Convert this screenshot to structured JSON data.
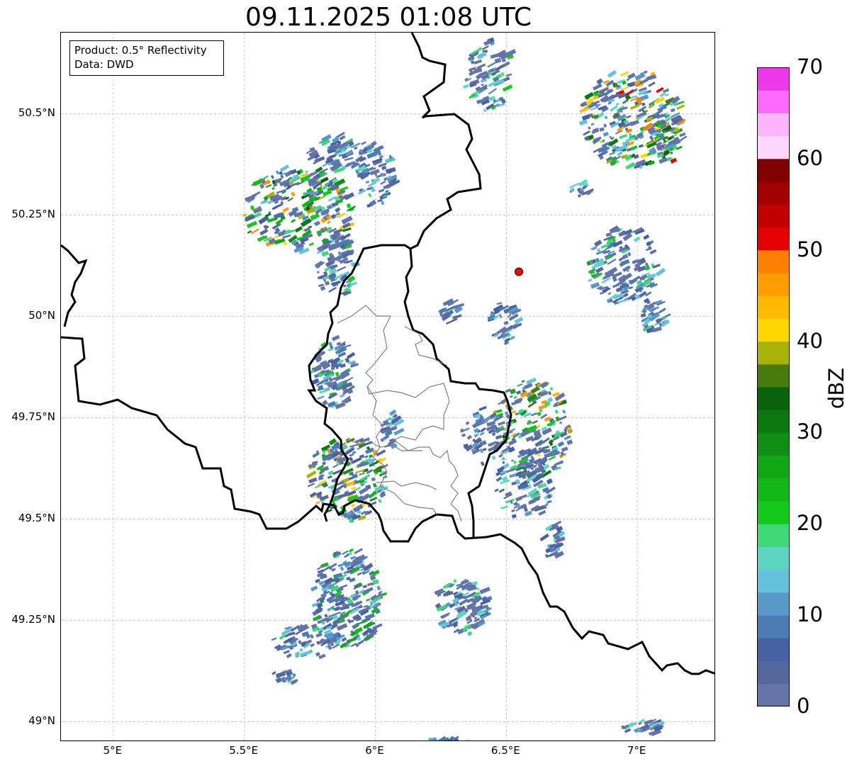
{
  "title": "09.11.2025 01:08 UTC",
  "info": {
    "product": "Product: 0.5° Reflectivity",
    "source": "Data: DWD"
  },
  "axes": {
    "lat_ticks": [
      {
        "label": "50.5°N",
        "value": 50.5
      },
      {
        "label": "50.25°N",
        "value": 50.25
      },
      {
        "label": "50°N",
        "value": 50.0
      },
      {
        "label": "49.75°N",
        "value": 49.75
      },
      {
        "label": "49.5°N",
        "value": 49.5
      },
      {
        "label": "49.25°N",
        "value": 49.25
      },
      {
        "label": "49°N",
        "value": 49.0
      }
    ],
    "lon_ticks": [
      {
        "label": "5°E",
        "value": 5.0
      },
      {
        "label": "5.5°E",
        "value": 5.5
      },
      {
        "label": "6°E",
        "value": 6.0
      },
      {
        "label": "6.5°E",
        "value": 6.5
      },
      {
        "label": "7°E",
        "value": 7.0
      }
    ],
    "lon_range": [
      4.8,
      7.3
    ],
    "lat_range": [
      48.95,
      50.7
    ],
    "grid": true
  },
  "radar_site": {
    "lon": 6.548,
    "lat": 50.11,
    "color": "#ff0000"
  },
  "colorbar": {
    "label": "dBZ",
    "min": 0,
    "max": 70,
    "ticks": [
      "0",
      "10",
      "20",
      "30",
      "40",
      "50",
      "60",
      "70"
    ],
    "colors": [
      "#6474a8",
      "#55689e",
      "#4560a3",
      "#4a7cb2",
      "#5899c8",
      "#66c1dc",
      "#5fd6c4",
      "#3ed878",
      "#14c81c",
      "#12b818",
      "#11a614",
      "#0e8e12",
      "#0b7810",
      "#0a620d",
      "#477b0d",
      "#a9b208",
      "#fed701",
      "#feba01",
      "#fe9c01",
      "#fe7e01",
      "#e40000",
      "#c20000",
      "#a20000",
      "#800000",
      "#fed6fe",
      "#feb4fe",
      "#fe6afe",
      "#ea38ea"
    ]
  }
}
